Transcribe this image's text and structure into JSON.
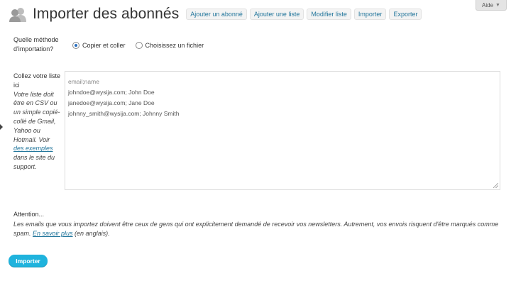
{
  "header": {
    "title": "Importer des abonnés",
    "nav": [
      "Ajouter un abonné",
      "Ajouter une liste",
      "Modifier liste",
      "Importer",
      "Exporter"
    ]
  },
  "help_tab": {
    "label": "Aide"
  },
  "method": {
    "label": "Quelle méthode d'importation?",
    "options": [
      {
        "label": "Copier et coller",
        "selected": true
      },
      {
        "label": "Choisissez un fichier",
        "selected": false
      }
    ]
  },
  "paste": {
    "title": "Collez votre liste ici",
    "note_before": "Votre liste doit être en CSV ou un simple copié-collé de Gmail, Yahoo ou Hotmail. Voir ",
    "note_link": "des exemples",
    "note_after": " dans le site du support.",
    "lines": [
      "email;name",
      "johndoe@wysija.com; John Doe",
      "janedoe@wysija.com; Jane Doe",
      "johnny_smith@wysija.com; Johnny Smith"
    ]
  },
  "attention": {
    "heading": "Attention...",
    "body_before": "Les emails que vous importez doivent être ceux de gens qui ont explicitement demandé de recevoir vos newsletters. Autrement, vos envois risquent d'être marqués comme spam. ",
    "link": "En savoir plus",
    "body_after": " (en anglais)."
  },
  "submit": {
    "label": "Importer"
  },
  "colors": {
    "accent": "#1fb3dd",
    "link": "#21759b"
  },
  "icons": {
    "logo": "users-logo-icon",
    "help_caret": "chevron-down-icon",
    "resize": "resize-grip-icon"
  }
}
